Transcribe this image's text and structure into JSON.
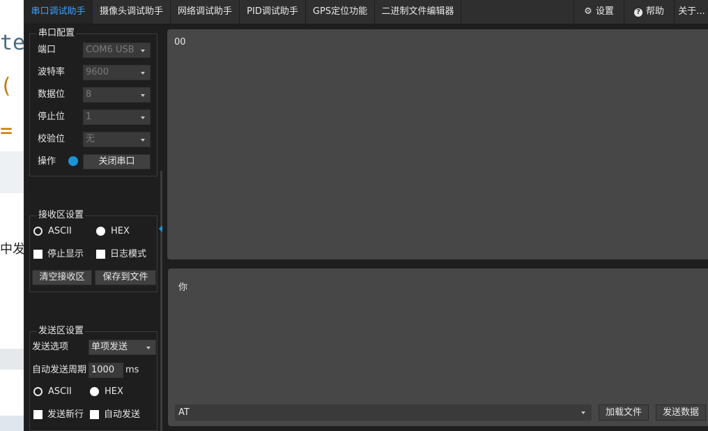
{
  "background": {
    "glyphs": [
      "te",
      "(",
      "="
    ],
    "cn_text": "中发"
  },
  "tabs": [
    {
      "label": "串口调试助手",
      "active": true
    },
    {
      "label": "摄像头调试助手",
      "active": false
    },
    {
      "label": "网络调试助手",
      "active": false
    },
    {
      "label": "PID调试助手",
      "active": false
    },
    {
      "label": "GPS定位功能",
      "active": false
    },
    {
      "label": "二进制文件编辑器",
      "active": false
    }
  ],
  "menu": {
    "settings": "设置",
    "help": "帮助",
    "about": "关于..."
  },
  "serial_config": {
    "title": "串口配置",
    "port_label": "端口",
    "port_value": "COM6 USB",
    "baud_label": "波特率",
    "baud_value": "9600",
    "databits_label": "数据位",
    "databits_value": "8",
    "stopbits_label": "停止位",
    "stopbits_value": "1",
    "parity_label": "校验位",
    "parity_value": "无",
    "operation_label": "操作",
    "close_button": "关闭串口",
    "status_color": "#1a93d8"
  },
  "receive_settings": {
    "title": "接收区设置",
    "ascii_label": "ASCII",
    "hex_label": "HEX",
    "selected_format": "HEX",
    "stop_display_label": "停止显示",
    "log_mode_label": "日志模式",
    "stop_display_checked": false,
    "log_mode_checked": false,
    "clear_button": "清空接收区",
    "save_button": "保存到文件"
  },
  "send_settings": {
    "title": "发送区设置",
    "send_option_label": "发送选项",
    "send_option_value": "单项发送",
    "auto_period_label": "自动发送周期",
    "auto_period_value": "1000",
    "auto_period_unit": "ms",
    "ascii_label": "ASCII",
    "hex_label": "HEX",
    "selected_format": "HEX",
    "newline_label": "发送新行",
    "auto_send_label": "自动发送",
    "newline_checked": false,
    "auto_send_checked": false
  },
  "receive_area": {
    "content": "00"
  },
  "send_area": {
    "content": "你",
    "command_value": "AT",
    "load_file_button": "加载文件",
    "send_data_button": "发送数据"
  }
}
